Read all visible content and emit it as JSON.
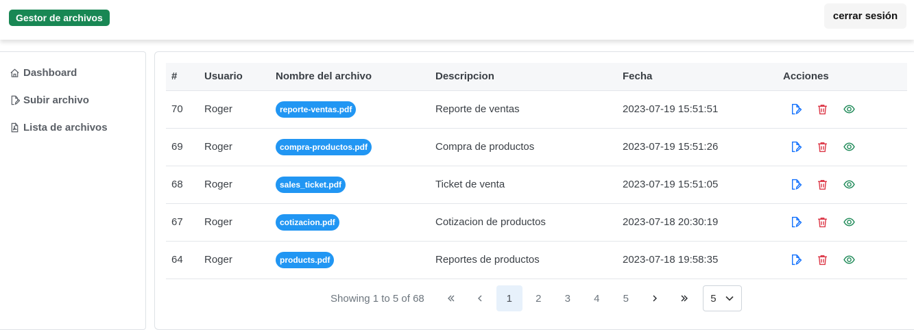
{
  "header": {
    "brand": "Gestor de archivos",
    "logout": "cerrar sesión"
  },
  "sidebar": {
    "items": [
      {
        "label": "Dashboard",
        "icon": "home-icon"
      },
      {
        "label": "Subir archivo",
        "icon": "file-upload-icon"
      },
      {
        "label": "Lista de archivos",
        "icon": "file-pdf-icon"
      }
    ]
  },
  "table": {
    "columns": [
      "#",
      "Usuario",
      "Nombre del archivo",
      "Descripcion",
      "Fecha",
      "Acciones"
    ],
    "rows": [
      {
        "id": "70",
        "user": "Roger",
        "file": "reporte-ventas.pdf",
        "desc": "Reporte de ventas",
        "date": "2023-07-19 15:51:51"
      },
      {
        "id": "69",
        "user": "Roger",
        "file": "compra-productos.pdf",
        "desc": "Compra de productos",
        "date": "2023-07-19 15:51:26"
      },
      {
        "id": "68",
        "user": "Roger",
        "file": "sales_ticket.pdf",
        "desc": "Ticket de venta",
        "date": "2023-07-19 15:51:05"
      },
      {
        "id": "67",
        "user": "Roger",
        "file": "cotizacion.pdf",
        "desc": "Cotizacion de productos",
        "date": "2023-07-18 20:30:19"
      },
      {
        "id": "64",
        "user": "Roger",
        "file": "products.pdf",
        "desc": "Reportes de productos",
        "date": "2023-07-18 19:58:35"
      }
    ],
    "action_colors": {
      "edit": "#0d6efd",
      "delete": "#dc3545",
      "view": "#198754"
    }
  },
  "pagination": {
    "showing": "Showing 1 to 5 of 68",
    "pages": [
      "1",
      "2",
      "3",
      "4",
      "5"
    ],
    "active_page": "1",
    "page_size": "5"
  }
}
